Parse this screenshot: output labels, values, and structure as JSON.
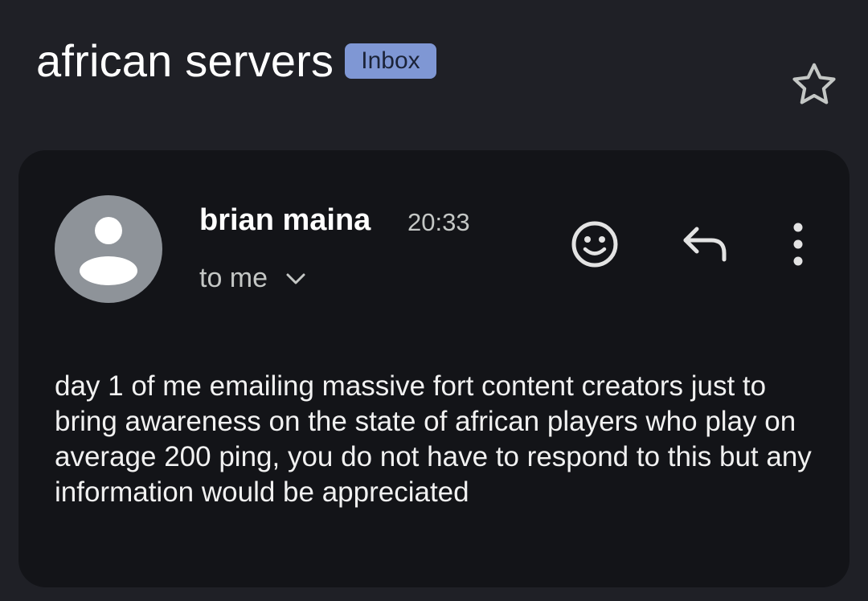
{
  "thread": {
    "subject": "african servers",
    "label": "Inbox"
  },
  "message": {
    "sender": "brian maina",
    "time": "20:33",
    "recipient": "to me",
    "body": "day 1 of me emailing massive fort content creators just to bring awareness on the state of african players who play on average 200 ping, you do not have to respond to this but any information would be appreciated"
  },
  "icons": [
    "star-icon",
    "avatar-icon",
    "chevron-down-icon",
    "smiley-icon",
    "reply-icon",
    "more-vert-icon"
  ],
  "colors": {
    "background": "#1f2026",
    "card": "#131418",
    "label_chip": "#7f97d4",
    "avatar": "#8e9399"
  }
}
